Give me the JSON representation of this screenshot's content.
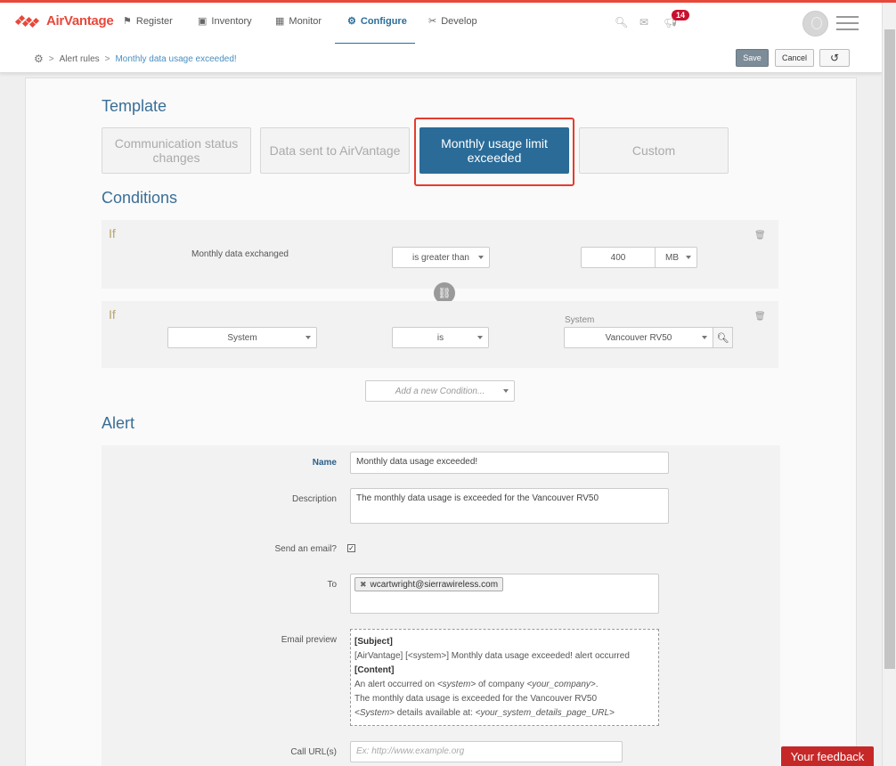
{
  "brand": {
    "name": "AirVantage",
    "accent": "#e8483a",
    "primary": "#2a6b98"
  },
  "nav": {
    "items": [
      {
        "label": "Register",
        "icon": "flag-icon"
      },
      {
        "label": "Inventory",
        "icon": "box-icon"
      },
      {
        "label": "Monitor",
        "icon": "dashboard-icon"
      },
      {
        "label": "Configure",
        "icon": "gear-icon",
        "active": true
      },
      {
        "label": "Develop",
        "icon": "tools-icon"
      }
    ],
    "notification_count": "14"
  },
  "breadcrumb": {
    "items": [
      "Alert rules",
      "Monthly data usage exceeded!"
    ]
  },
  "toolbar": {
    "save_label": "Save",
    "cancel_label": "Cancel",
    "undo_glyph": "↺"
  },
  "template": {
    "title": "Template",
    "options": [
      {
        "label": "Communication status changes"
      },
      {
        "label": "Data sent to AirVantage"
      },
      {
        "label": "Monthly usage limit exceeded",
        "selected": true
      },
      {
        "label": "Custom"
      }
    ]
  },
  "conditions": {
    "title": "Conditions",
    "items": [
      {
        "if_label": "If",
        "field": "Monthly data exchanged",
        "operator": "is greater than",
        "value": "400",
        "unit": "MB"
      },
      {
        "if_label": "If",
        "field": "System",
        "operator": "is",
        "value_label": "System",
        "value": "Vancouver RV50"
      }
    ],
    "add_placeholder": "Add a new Condition..."
  },
  "alert": {
    "title": "Alert",
    "name_label": "Name",
    "name_value": "Monthly data usage exceeded!",
    "description_label": "Description",
    "description_value": "The monthly data usage is exceeded for the Vancouver RV50",
    "send_email_label": "Send an email?",
    "send_email_checked": true,
    "to_label": "To",
    "to_recipients": [
      "wcartwright@sierrawireless.com"
    ],
    "preview_label": "Email preview",
    "preview": {
      "subject_head": "[Subject]",
      "subject_text": "[AirVantage] [<system>] Monthly data usage exceeded! alert occurred",
      "content_head": "[Content]",
      "line1_a": "An alert occurred on ",
      "line1_b": "<system>",
      "line1_c": " of company ",
      "line1_d": "<your_company>",
      "line1_e": ".",
      "line2": "The monthly data usage is exceeded for the Vancouver RV50",
      "line3_a": "<System>",
      "line3_b": " details available at: ",
      "line3_c": "<your_system_details_page_URL>"
    },
    "callurl_label": "Call URL(s)",
    "callurl_placeholder": "Ex: http://www.example.org"
  },
  "feedback_label": "Your feedback"
}
